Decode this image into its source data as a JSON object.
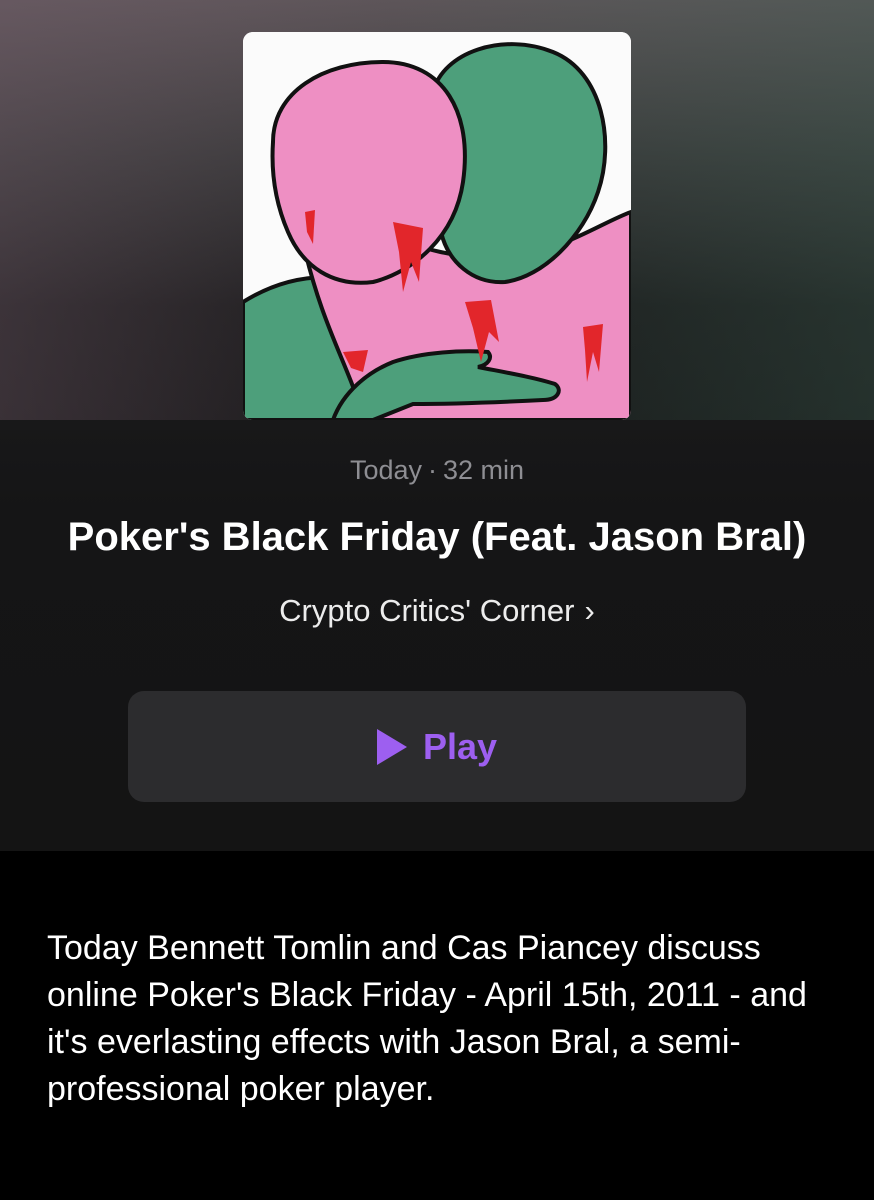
{
  "episode": {
    "artwork_icon": "podcast-artwork-two-figures-embracing",
    "date": "Today",
    "separator": "·",
    "duration": "32 min",
    "title": "Poker's Black Friday (Feat. Jason Bral)",
    "show_name": "Crypto Critics' Corner",
    "show_chevron": "›",
    "play_label": "Play",
    "play_icon": "play-triangle-icon",
    "description": "Today Bennett Tomlin and Cas Piancey discuss online Poker's Black Friday - April 15th, 2011 - and it's everlasting effects with Jason Bral, a semi-professional poker player."
  },
  "colors": {
    "accent": "#9d5ff0",
    "button_bg": "#2c2c2e",
    "meta_text": "#8e8e93"
  }
}
